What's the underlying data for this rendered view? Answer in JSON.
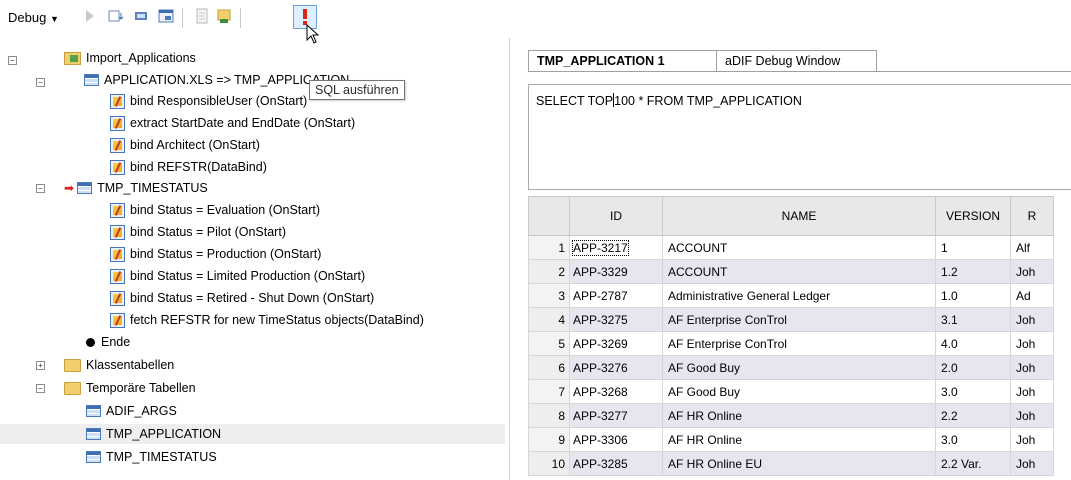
{
  "toolbar": {
    "debug_label": "Debug",
    "tooltip": "SQL ausführen"
  },
  "tree": {
    "root": "Import_Applications",
    "app_node": "APPLICATION.XLS => TMP_APPLICATION",
    "app_children": [
      "bind ResponsibleUser (OnStart)",
      "extract StartDate and EndDate (OnStart)",
      "bind Architect (OnStart)",
      "bind REFSTR(DataBind)"
    ],
    "timestatus_node": "TMP_TIMESTATUS",
    "timestatus_children": [
      "bind Status = Evaluation (OnStart)",
      "bind Status = Pilot (OnStart)",
      "bind Status = Production (OnStart)",
      "bind Status = Limited Production (OnStart)",
      "bind Status = Retired - Shut Down (OnStart)",
      "fetch REFSTR for new TimeStatus objects(DataBind)"
    ],
    "end_node": "Ende",
    "klassen": "Klassentabellen",
    "temp": "Temporäre Tabellen",
    "temp_children": [
      "ADIF_ARGS",
      "TMP_APPLICATION",
      "TMP_TIMESTATUS"
    ]
  },
  "tabs": [
    "TMP_APPLICATION 1",
    "aDIF Debug Window"
  ],
  "sql": {
    "before_caret": "SELECT TOP",
    "after_caret": "100 * FROM TMP_APPLICATION"
  },
  "grid": {
    "columns": [
      "",
      "ID",
      "NAME",
      "VERSION",
      "R"
    ],
    "rows": [
      {
        "n": "1",
        "id": "APP-3217",
        "name": "ACCOUNT",
        "version": "1",
        "r": "Alf"
      },
      {
        "n": "2",
        "id": "APP-3329",
        "name": "ACCOUNT",
        "version": "1.2",
        "r": "Joh"
      },
      {
        "n": "3",
        "id": "APP-2787",
        "name": "Administrative General Ledger",
        "version": "1.0",
        "r": "Ad"
      },
      {
        "n": "4",
        "id": "APP-3275",
        "name": "AF Enterprise ConTrol",
        "version": "3.1",
        "r": "Joh"
      },
      {
        "n": "5",
        "id": "APP-3269",
        "name": "AF Enterprise ConTrol",
        "version": "4.0",
        "r": "Joh"
      },
      {
        "n": "6",
        "id": "APP-3276",
        "name": "AF Good Buy",
        "version": "2.0",
        "r": "Joh"
      },
      {
        "n": "7",
        "id": "APP-3268",
        "name": "AF Good Buy",
        "version": "3.0",
        "r": "Joh"
      },
      {
        "n": "8",
        "id": "APP-3277",
        "name": "AF HR Online",
        "version": "2.2",
        "r": "Joh"
      },
      {
        "n": "9",
        "id": "APP-3306",
        "name": "AF HR Online",
        "version": "3.0",
        "r": "Joh"
      },
      {
        "n": "10",
        "id": "APP-3285",
        "name": "AF HR Online EU",
        "version": "2.2 Var.",
        "r": "Joh"
      }
    ]
  }
}
